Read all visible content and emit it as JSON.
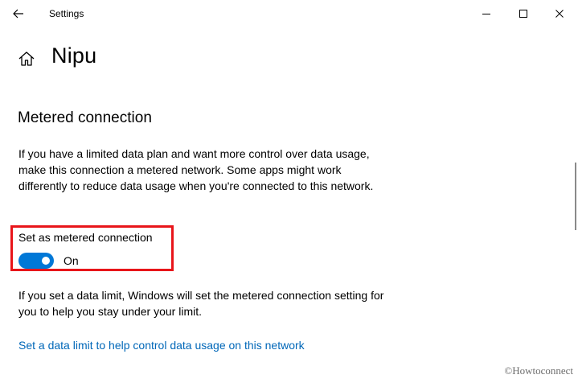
{
  "window": {
    "title": "Settings"
  },
  "header": {
    "page_title": "Nipu"
  },
  "section": {
    "title": "Metered connection",
    "description": "If you have a limited data plan and want more control over data usage, make this connection a metered network. Some apps might work differently to reduce data usage when you're connected to this network."
  },
  "toggle": {
    "label": "Set as metered connection",
    "state_label": "On",
    "is_on": true
  },
  "info": {
    "text": "If you set a data limit, Windows will set the metered connection setting for you to help you stay under your limit."
  },
  "link": {
    "label": "Set a data limit to help control data usage on this network"
  },
  "watermark": {
    "text": "©Howtoconnect"
  },
  "colors": {
    "accent": "#0078d7",
    "link": "#0067b8",
    "highlight": "#e8151a"
  },
  "icons": {
    "back": "back-arrow-icon",
    "minimize": "minimize-icon",
    "maximize": "maximize-icon",
    "close": "close-icon",
    "home": "home-icon"
  }
}
